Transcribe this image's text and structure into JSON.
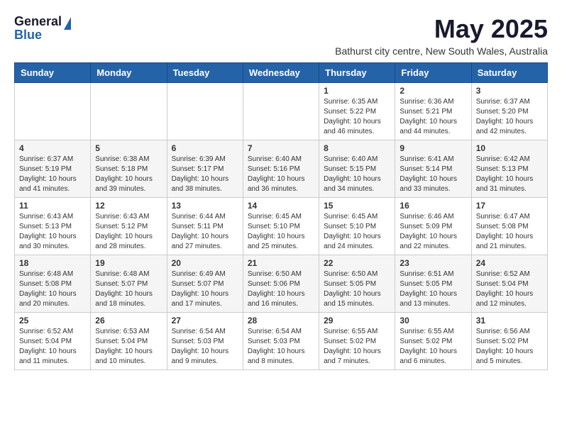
{
  "logo": {
    "general": "General",
    "blue": "Blue"
  },
  "title": {
    "month_year": "May 2025",
    "location": "Bathurst city centre, New South Wales, Australia"
  },
  "days_of_week": [
    "Sunday",
    "Monday",
    "Tuesday",
    "Wednesday",
    "Thursday",
    "Friday",
    "Saturday"
  ],
  "weeks": [
    [
      {
        "day": "",
        "info": ""
      },
      {
        "day": "",
        "info": ""
      },
      {
        "day": "",
        "info": ""
      },
      {
        "day": "",
        "info": ""
      },
      {
        "day": "1",
        "sunrise": "6:35 AM",
        "sunset": "5:22 PM",
        "daylight": "10 hours and 46 minutes."
      },
      {
        "day": "2",
        "sunrise": "6:36 AM",
        "sunset": "5:21 PM",
        "daylight": "10 hours and 44 minutes."
      },
      {
        "day": "3",
        "sunrise": "6:37 AM",
        "sunset": "5:20 PM",
        "daylight": "10 hours and 42 minutes."
      }
    ],
    [
      {
        "day": "4",
        "sunrise": "6:37 AM",
        "sunset": "5:19 PM",
        "daylight": "10 hours and 41 minutes."
      },
      {
        "day": "5",
        "sunrise": "6:38 AM",
        "sunset": "5:18 PM",
        "daylight": "10 hours and 39 minutes."
      },
      {
        "day": "6",
        "sunrise": "6:39 AM",
        "sunset": "5:17 PM",
        "daylight": "10 hours and 38 minutes."
      },
      {
        "day": "7",
        "sunrise": "6:40 AM",
        "sunset": "5:16 PM",
        "daylight": "10 hours and 36 minutes."
      },
      {
        "day": "8",
        "sunrise": "6:40 AM",
        "sunset": "5:15 PM",
        "daylight": "10 hours and 34 minutes."
      },
      {
        "day": "9",
        "sunrise": "6:41 AM",
        "sunset": "5:14 PM",
        "daylight": "10 hours and 33 minutes."
      },
      {
        "day": "10",
        "sunrise": "6:42 AM",
        "sunset": "5:13 PM",
        "daylight": "10 hours and 31 minutes."
      }
    ],
    [
      {
        "day": "11",
        "sunrise": "6:43 AM",
        "sunset": "5:13 PM",
        "daylight": "10 hours and 30 minutes."
      },
      {
        "day": "12",
        "sunrise": "6:43 AM",
        "sunset": "5:12 PM",
        "daylight": "10 hours and 28 minutes."
      },
      {
        "day": "13",
        "sunrise": "6:44 AM",
        "sunset": "5:11 PM",
        "daylight": "10 hours and 27 minutes."
      },
      {
        "day": "14",
        "sunrise": "6:45 AM",
        "sunset": "5:10 PM",
        "daylight": "10 hours and 25 minutes."
      },
      {
        "day": "15",
        "sunrise": "6:45 AM",
        "sunset": "5:10 PM",
        "daylight": "10 hours and 24 minutes."
      },
      {
        "day": "16",
        "sunrise": "6:46 AM",
        "sunset": "5:09 PM",
        "daylight": "10 hours and 22 minutes."
      },
      {
        "day": "17",
        "sunrise": "6:47 AM",
        "sunset": "5:08 PM",
        "daylight": "10 hours and 21 minutes."
      }
    ],
    [
      {
        "day": "18",
        "sunrise": "6:48 AM",
        "sunset": "5:08 PM",
        "daylight": "10 hours and 20 minutes."
      },
      {
        "day": "19",
        "sunrise": "6:48 AM",
        "sunset": "5:07 PM",
        "daylight": "10 hours and 18 minutes."
      },
      {
        "day": "20",
        "sunrise": "6:49 AM",
        "sunset": "5:07 PM",
        "daylight": "10 hours and 17 minutes."
      },
      {
        "day": "21",
        "sunrise": "6:50 AM",
        "sunset": "5:06 PM",
        "daylight": "10 hours and 16 minutes."
      },
      {
        "day": "22",
        "sunrise": "6:50 AM",
        "sunset": "5:05 PM",
        "daylight": "10 hours and 15 minutes."
      },
      {
        "day": "23",
        "sunrise": "6:51 AM",
        "sunset": "5:05 PM",
        "daylight": "10 hours and 13 minutes."
      },
      {
        "day": "24",
        "sunrise": "6:52 AM",
        "sunset": "5:04 PM",
        "daylight": "10 hours and 12 minutes."
      }
    ],
    [
      {
        "day": "25",
        "sunrise": "6:52 AM",
        "sunset": "5:04 PM",
        "daylight": "10 hours and 11 minutes."
      },
      {
        "day": "26",
        "sunrise": "6:53 AM",
        "sunset": "5:04 PM",
        "daylight": "10 hours and 10 minutes."
      },
      {
        "day": "27",
        "sunrise": "6:54 AM",
        "sunset": "5:03 PM",
        "daylight": "10 hours and 9 minutes."
      },
      {
        "day": "28",
        "sunrise": "6:54 AM",
        "sunset": "5:03 PM",
        "daylight": "10 hours and 8 minutes."
      },
      {
        "day": "29",
        "sunrise": "6:55 AM",
        "sunset": "5:02 PM",
        "daylight": "10 hours and 7 minutes."
      },
      {
        "day": "30",
        "sunrise": "6:55 AM",
        "sunset": "5:02 PM",
        "daylight": "10 hours and 6 minutes."
      },
      {
        "day": "31",
        "sunrise": "6:56 AM",
        "sunset": "5:02 PM",
        "daylight": "10 hours and 5 minutes."
      }
    ]
  ]
}
